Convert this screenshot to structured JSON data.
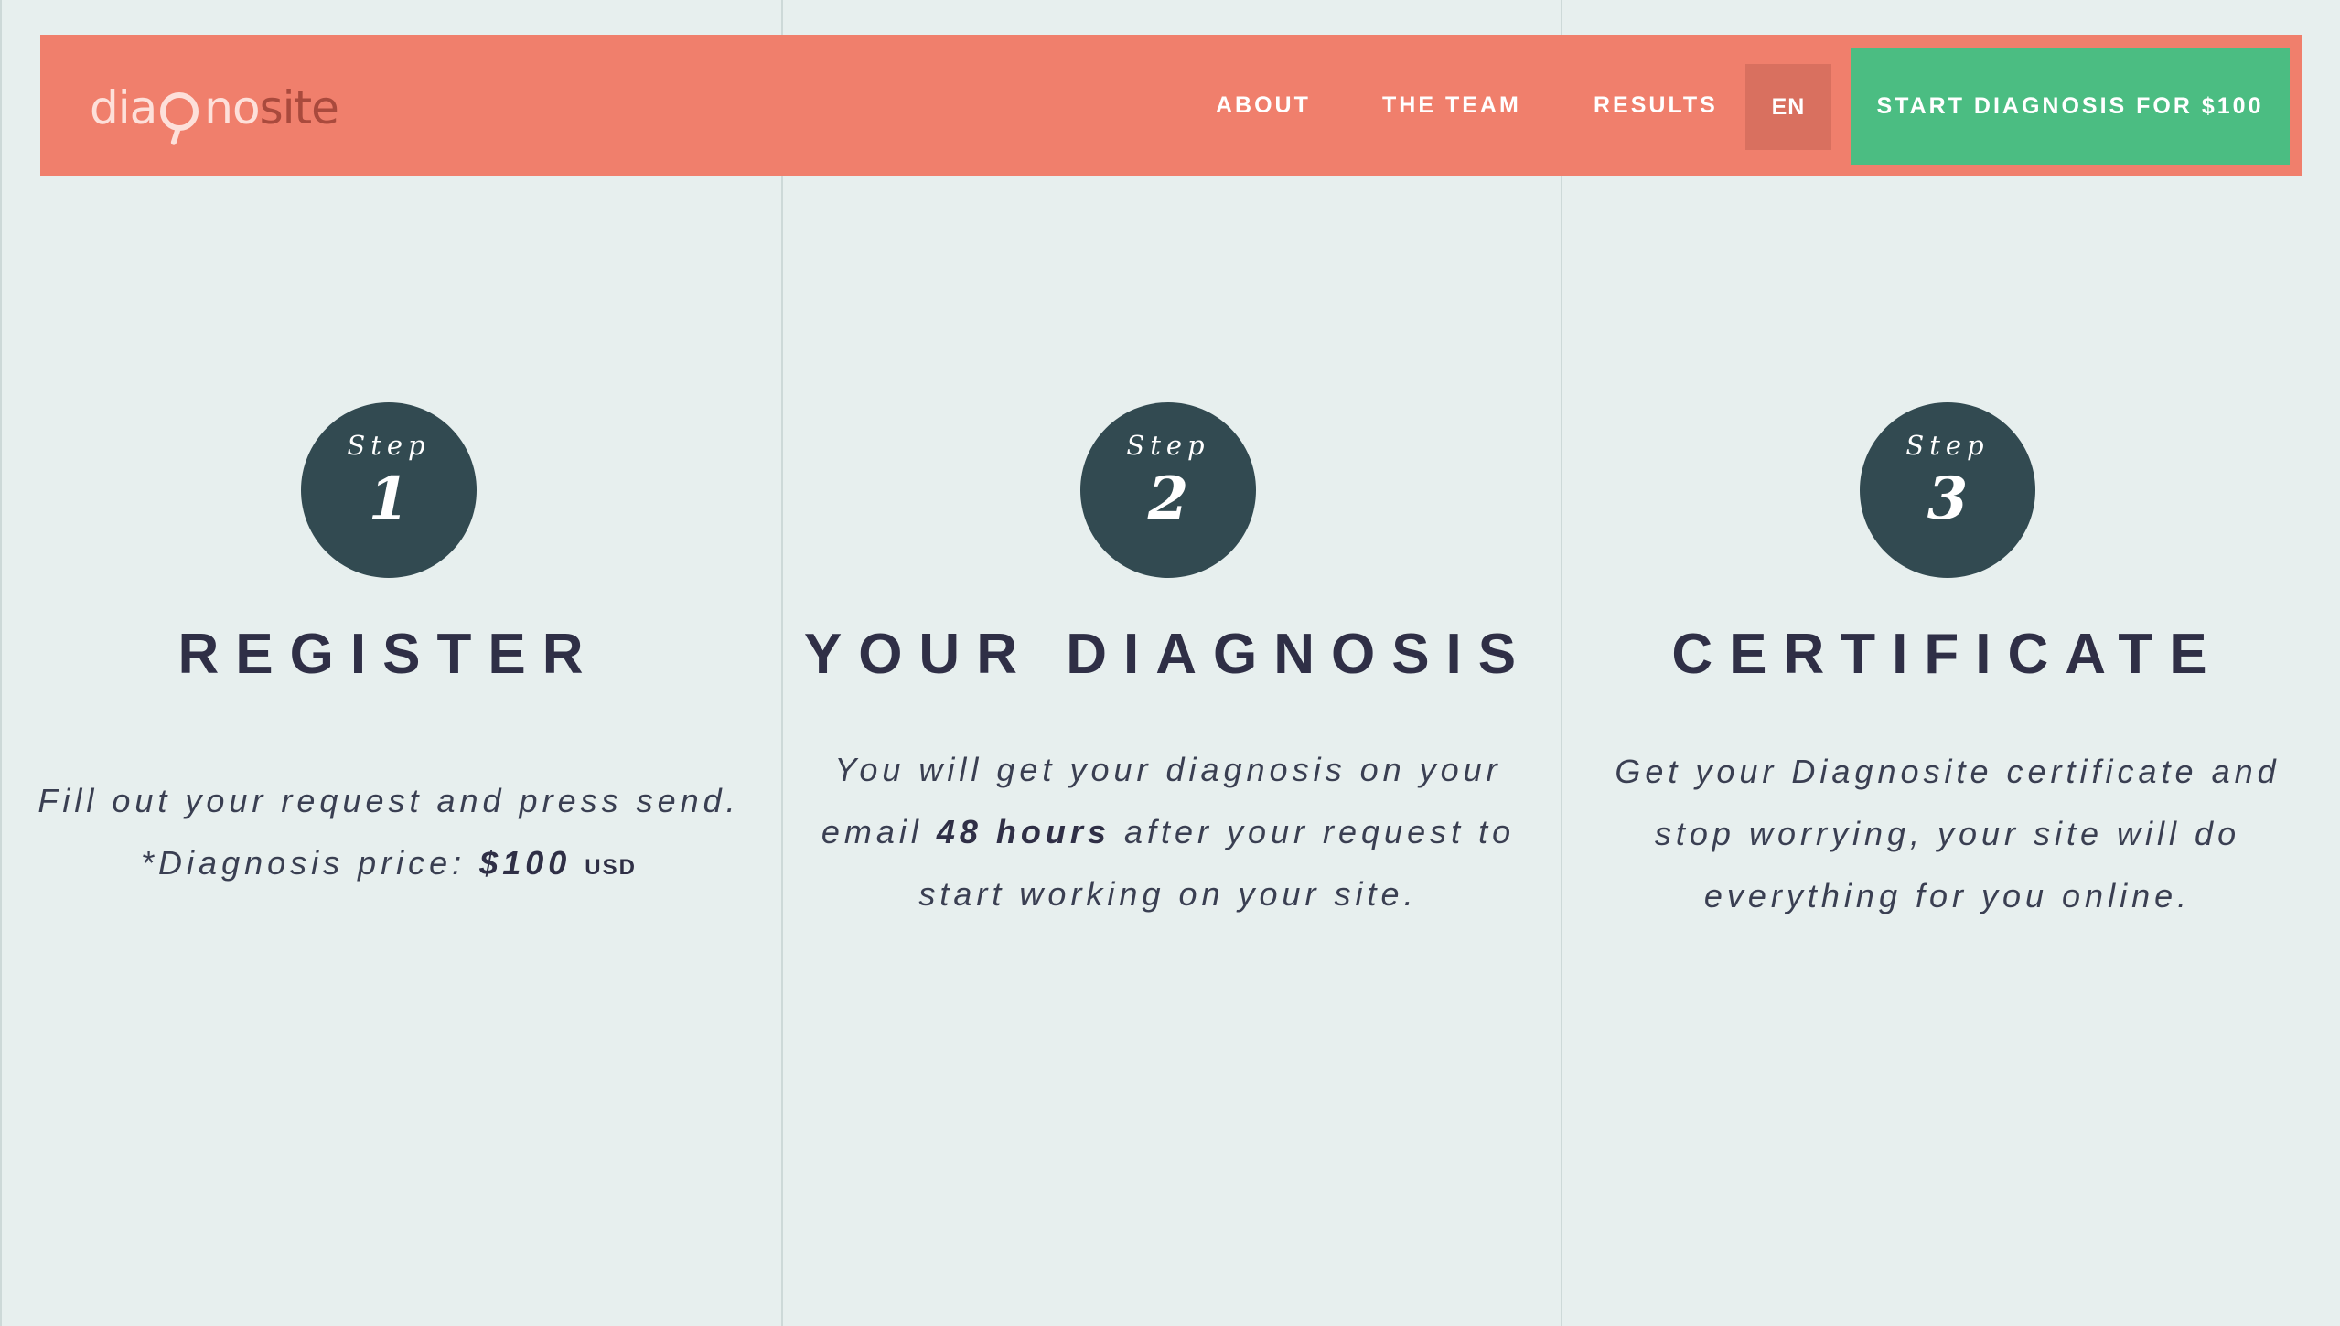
{
  "header": {
    "logo": {
      "part1": "dia",
      "part2": "no",
      "part3": "site"
    },
    "nav": [
      {
        "label": "ABOUT"
      },
      {
        "label": "THE TEAM"
      },
      {
        "label": "RESULTS"
      }
    ],
    "language": "EN",
    "cta_label": "START DIAGNOSIS FOR $100"
  },
  "colors": {
    "header_bg": "#f07f6c",
    "cta_bg": "#4bbd82",
    "badge_bg": "#324a51",
    "page_bg": "#e7efee"
  },
  "steps": [
    {
      "badge_word": "Step",
      "badge_number": "1",
      "title": "REGISTER",
      "desc_line1": "Fill out your request and press send.",
      "desc_prefix": "*Diagnosis price: ",
      "price": "$100",
      "currency": "USD"
    },
    {
      "badge_word": "Step",
      "badge_number": "2",
      "title": "YOUR DIAGNOSIS",
      "desc_before": "You will get your diagnosis on your email ",
      "desc_bold": "48 hours",
      "desc_after": " after your request to start working on your site."
    },
    {
      "badge_word": "Step",
      "badge_number": "3",
      "title": "CERTIFICATE",
      "desc": "Get your Diagnosite certificate and stop worrying, your site will do everything for you online."
    }
  ]
}
